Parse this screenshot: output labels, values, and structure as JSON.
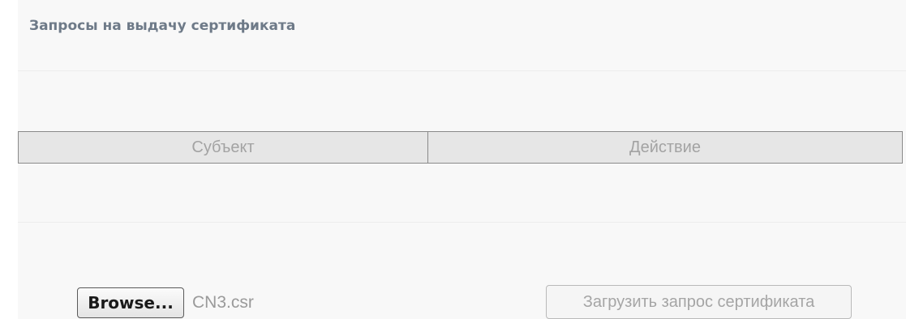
{
  "section": {
    "title": "Запросы на выдачу сертификата"
  },
  "table": {
    "columns": [
      "Субъект",
      "Действие"
    ]
  },
  "file_input": {
    "browse_label": "Browse...",
    "selected_file": "CN3.csr"
  },
  "upload": {
    "label": "Загрузить запрос сертификата",
    "disabled": true
  }
}
